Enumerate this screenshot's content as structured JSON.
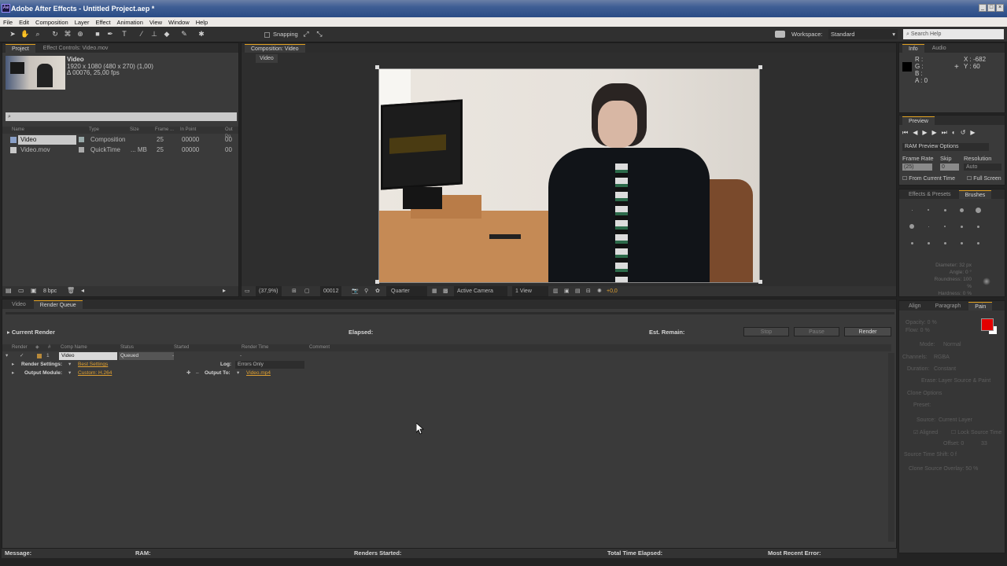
{
  "window": {
    "title": "Adobe After Effects - Untitled Project.aep *",
    "logo": "Ae"
  },
  "menu": [
    "File",
    "Edit",
    "Composition",
    "Layer",
    "Effect",
    "Animation",
    "View",
    "Window",
    "Help"
  ],
  "toolbar": {
    "snapping_label": "Snapping",
    "workspace_label": "Workspace:",
    "workspace_value": "Standard",
    "search_placeholder": "Search Help"
  },
  "project_panel": {
    "tab_project": "Project",
    "tab_effect_controls": "Effect Controls: Video.mov",
    "item_name": "Video",
    "item_dims": "1920 x 1080  (480 x 270) (1,00)",
    "item_duration": "Δ 00076, 25,00 fps",
    "search_placeholder": "⌕",
    "columns": [
      "Name",
      "Type",
      "Size",
      "Frame ...",
      "In Point",
      "Out Po"
    ],
    "rows": [
      {
        "name": "Video",
        "type": "Composition",
        "size": "",
        "frame": "25",
        "in": "00000",
        "out": "00"
      },
      {
        "name": "Video.mov",
        "type": "QuickTime",
        "size": "... MB",
        "frame": "25",
        "in": "00000",
        "out": "00"
      }
    ],
    "bpc": "8 bpc"
  },
  "composition_panel": {
    "tab": "Composition: Video",
    "subtab": "Video",
    "zoom": "(37,9%)",
    "timecode": "00012",
    "resolution": "Quarter",
    "camera": "Active Camera",
    "views": "1 View",
    "exposure": "+0,0"
  },
  "info_panel": {
    "tab_info": "Info",
    "tab_audio": "Audio",
    "r": "R :",
    "g": "G :",
    "b": "B :",
    "a": "A : 0",
    "x": "X : -682",
    "y": "Y : 60"
  },
  "preview_panel": {
    "tab": "Preview",
    "ram_options": "RAM Preview Options",
    "frame_rate_label": "Frame Rate",
    "skip_label": "Skip",
    "resolution_label": "Resolution",
    "frame_rate_value": "(25)",
    "skip_value": "0",
    "resolution_value": "Auto",
    "from_current": "From Current Time",
    "full_screen": "Full Screen"
  },
  "brushes_panel": {
    "tab_effects": "Effects & Presets",
    "tab_brushes": "Brushes",
    "diameter": "Diameter: 32 px",
    "angle": "Angle: 0 °",
    "roundness": "Roundness: 100 %",
    "hardness": "Hardness: 0 %"
  },
  "paint_panel": {
    "tab_align": "Align",
    "tab_paragraph": "Paragraph",
    "tab_paint": "Pain",
    "opacity": "Opacity: 0 %",
    "flow": "Flow: 0 %",
    "mode_label": "Mode:",
    "mode_value": "Normal",
    "channels_label": "Channels:",
    "channels_value": "RGBA",
    "duration_label": "Duration:",
    "duration_value": "Constant",
    "erase_label": "Erase:",
    "erase_value": "Layer Source & Paint",
    "clone_options": "Clone Options",
    "preset_label": "Preset:",
    "source_label": "Source:",
    "source_value": "Current Layer",
    "aligned": "Aligned",
    "lock_source": "Lock Source Time",
    "offset_label": "Offset: 0",
    "offset_value": "33",
    "source_time_shift": "Source Time Shift: 0 f",
    "clone_overlay": "Clone Source Overlay: 50 %",
    "fg_color": "#e30000",
    "bg_color": "#ffffff"
  },
  "render_queue": {
    "tab_video": "Video",
    "tab_render_queue": "Render Queue",
    "current_render": "Current Render",
    "elapsed": "Elapsed:",
    "est_remain": "Est. Remain:",
    "stop": "Stop",
    "pause": "Pause",
    "render": "Render",
    "columns": [
      "Render",
      "#",
      "Comp Name",
      "Status",
      "Started",
      "Render Time",
      "Comment"
    ],
    "item": {
      "num": "1",
      "comp": "Video",
      "status": "Queued",
      "started": "-",
      "render_time": "-"
    },
    "render_settings_label": "Render Settings:",
    "render_settings_value": "Best Settings",
    "log_label": "Log:",
    "log_value": "Errors Only",
    "output_module_label": "Output Module:",
    "output_module_value": "Custom: H.264",
    "output_to_label": "Output To:",
    "output_to_value": "Video.mp4",
    "status_message": "Message:",
    "status_ram": "RAM:",
    "status_renders_started": "Renders Started:",
    "status_total_elapsed": "Total Time Elapsed:",
    "status_recent_error": "Most Recent Error:"
  }
}
